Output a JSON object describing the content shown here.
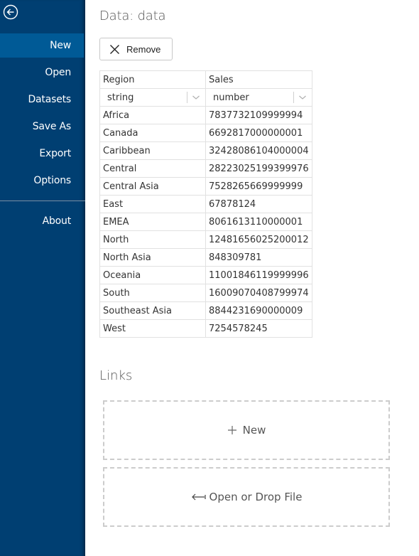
{
  "sidebar": {
    "back_icon": "arrow-left-circle-icon",
    "items": [
      {
        "label": "New",
        "active": true
      },
      {
        "label": "Open"
      },
      {
        "label": "Datasets"
      },
      {
        "label": "Save As"
      },
      {
        "label": "Export"
      },
      {
        "label": "Options"
      },
      {
        "label": "About"
      }
    ],
    "colors": {
      "background": "#003f72",
      "active": "#005a96"
    }
  },
  "main": {
    "title": "Data: data",
    "remove_label": "Remove",
    "table": {
      "columns": [
        {
          "name": "Region",
          "type": "string"
        },
        {
          "name": "Sales",
          "type": "number"
        }
      ],
      "rows": [
        [
          "Africa",
          "7837732109999994"
        ],
        [
          "Canada",
          "6692817000000001"
        ],
        [
          "Caribbean",
          "32428086104000004"
        ],
        [
          "Central",
          "28223025199399976"
        ],
        [
          "Central Asia",
          "7528265669999999"
        ],
        [
          "East",
          "67878124"
        ],
        [
          "EMEA",
          "8061613110000001"
        ],
        [
          "North",
          "12481656025200012"
        ],
        [
          "North Asia",
          "848309781"
        ],
        [
          "Oceania",
          "11001846119999996"
        ],
        [
          "South",
          "16009070408799974"
        ],
        [
          "Southeast Asia",
          "8844231690000009"
        ],
        [
          "West",
          "7254578245"
        ]
      ]
    },
    "links": {
      "title": "Links",
      "new_label": "New",
      "open_label": "Open or Drop File"
    }
  }
}
